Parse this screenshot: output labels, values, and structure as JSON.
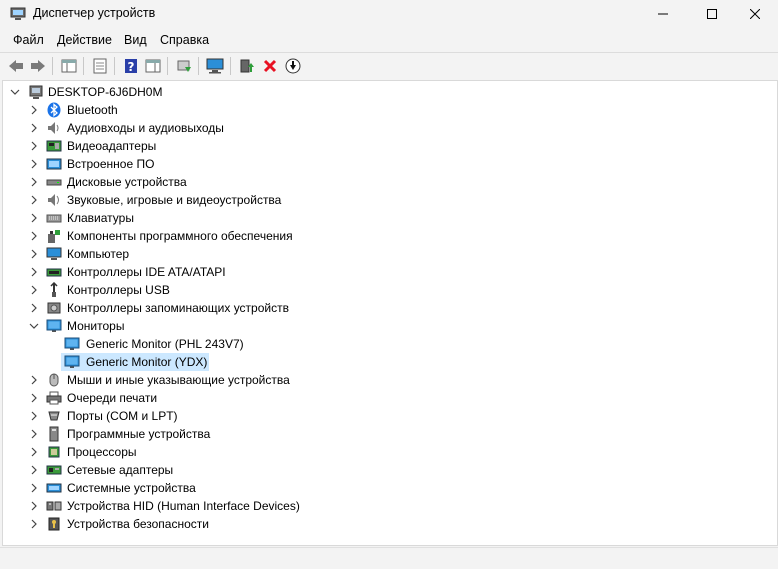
{
  "window": {
    "title": "Диспетчер устройств"
  },
  "menu": [
    "Файл",
    "Действие",
    "Вид",
    "Справка"
  ],
  "tree": {
    "root": "DESKTOP-6J6DH0M",
    "categories": [
      {
        "label": "Bluetooth",
        "icon": "bluetooth-icon"
      },
      {
        "label": "Аудиовходы и аудиовыходы",
        "icon": "speaker-icon"
      },
      {
        "label": "Видеоадаптеры",
        "icon": "display-adapter-icon"
      },
      {
        "label": "Встроенное ПО",
        "icon": "firmware-icon"
      },
      {
        "label": "Дисковые устройства",
        "icon": "disk-drive-icon"
      },
      {
        "label": "Звуковые, игровые и видеоустройства",
        "icon": "sound-icon"
      },
      {
        "label": "Клавиатуры",
        "icon": "keyboard-icon"
      },
      {
        "label": "Компоненты программного обеспечения",
        "icon": "software-component-icon"
      },
      {
        "label": "Компьютер",
        "icon": "computer-icon"
      },
      {
        "label": "Контроллеры IDE ATA/ATAPI",
        "icon": "ide-controller-icon"
      },
      {
        "label": "Контроллеры USB",
        "icon": "usb-icon"
      },
      {
        "label": "Контроллеры запоминающих устройств",
        "icon": "storage-controller-icon"
      },
      {
        "label": "Мониторы",
        "icon": "monitor-icon",
        "expanded": true,
        "children": [
          {
            "label": "Generic Monitor (PHL 243V7)",
            "icon": "monitor-icon"
          },
          {
            "label": "Generic Monitor (YDX)",
            "icon": "monitor-icon",
            "selected": true
          }
        ]
      },
      {
        "label": "Мыши и иные указывающие устройства",
        "icon": "mouse-icon"
      },
      {
        "label": "Очереди печати",
        "icon": "printer-icon"
      },
      {
        "label": "Порты (COM и LPT)",
        "icon": "port-icon"
      },
      {
        "label": "Программные устройства",
        "icon": "software-device-icon"
      },
      {
        "label": "Процессоры",
        "icon": "processor-icon"
      },
      {
        "label": "Сетевые адаптеры",
        "icon": "network-adapter-icon"
      },
      {
        "label": "Системные устройства",
        "icon": "system-device-icon"
      },
      {
        "label": "Устройства HID (Human Interface Devices)",
        "icon": "hid-icon"
      },
      {
        "label": "Устройства безопасности",
        "icon": "security-device-icon"
      }
    ]
  },
  "colors": {
    "selection": "#cce8ff",
    "accent": "#0078d4",
    "delete": "#e81123"
  }
}
